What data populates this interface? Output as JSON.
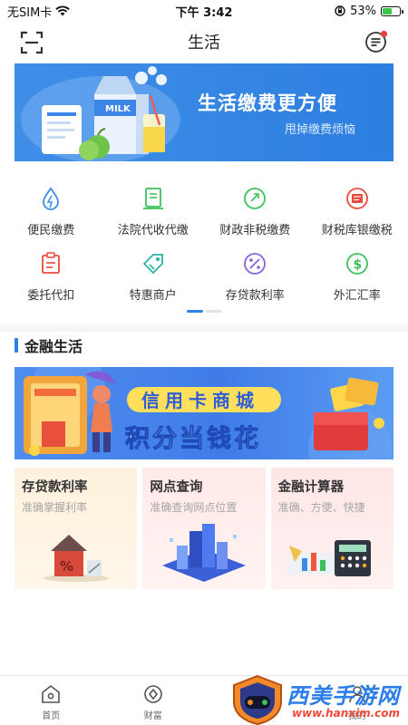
{
  "status_bar": {
    "carrier": "无SIM卡",
    "time": "下午 3:42",
    "battery_percent": "53%",
    "battery_level": 0.53
  },
  "nav": {
    "title": "生活",
    "left_icon": "scan-icon",
    "right_icon": "message-icon",
    "has_notification_dot": true
  },
  "banner": {
    "title": "生活缴费更方便",
    "subtitle": "甩掉缴费烦恼",
    "milk_label": "MILK",
    "background": "#3f8ee8"
  },
  "services": [
    {
      "label": "便民缴费",
      "icon": "water-drop-icon",
      "color": "#3b8de8"
    },
    {
      "label": "法院代收代缴",
      "icon": "document-icon",
      "color": "#3cc15a"
    },
    {
      "label": "财政非税缴费",
      "icon": "coin-icon",
      "color": "#3cc15a"
    },
    {
      "label": "财税库银缴税",
      "icon": "tax-icon",
      "color": "#e84b3c"
    },
    {
      "label": "委托代扣",
      "icon": "delegate-icon",
      "color": "#e84b3c"
    },
    {
      "label": "特惠商户",
      "icon": "tag-icon",
      "color": "#2bb3a6"
    },
    {
      "label": "存贷款利率",
      "icon": "percent-icon",
      "color": "#8a5fe0"
    },
    {
      "label": "外汇汇率",
      "icon": "dollar-icon",
      "color": "#3cc15a"
    }
  ],
  "pager": {
    "active": 1,
    "total": 2
  },
  "section": {
    "title": "金融生活"
  },
  "promo": {
    "line1": "信用卡商城",
    "line2": "积分当钱花"
  },
  "cards": [
    {
      "title": "存贷款利率",
      "subtitle": "准确掌握利率",
      "icon": "house-percent-icon"
    },
    {
      "title": "网点查询",
      "subtitle": "准确查询网点位置",
      "icon": "city-buildings-icon"
    },
    {
      "title": "金融计算器",
      "subtitle": "准确、方便、快捷",
      "icon": "calculator-icon"
    }
  ],
  "tabs": [
    {
      "label": "首页",
      "icon": "home-icon"
    },
    {
      "label": "财富",
      "icon": "wealth-icon"
    },
    {
      "label": "",
      "icon": "life-icon"
    },
    {
      "label": "我的",
      "icon": "profile-icon"
    }
  ],
  "watermark": {
    "text": "西美手游网",
    "url": "www.hanxim.com"
  },
  "colors": {
    "accent": "#2d7fe0",
    "text": "#222222",
    "muted": "#a6a6a6"
  }
}
